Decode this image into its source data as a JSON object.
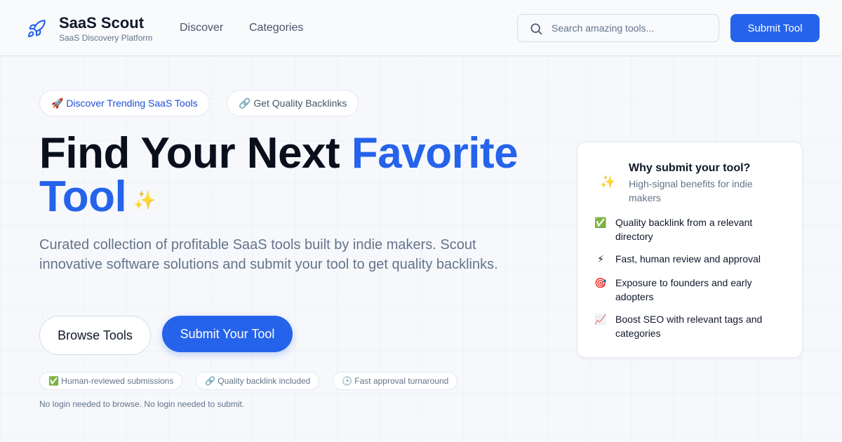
{
  "header": {
    "brand_title": "SaaS Scout",
    "brand_subtitle": "SaaS Discovery Platform",
    "nav": {
      "discover": "Discover",
      "categories": "Categories"
    },
    "search_placeholder": "Search amazing tools...",
    "submit_label": "Submit Tool"
  },
  "hero": {
    "pills": {
      "trending": "🚀 Discover Trending SaaS Tools",
      "backlinks": "🔗 Get Quality Backlinks"
    },
    "headline_plain": "Find Your Next ",
    "headline_accent_1": "Favorite",
    "headline_accent_2": "Tool",
    "headline_emoji": "✨",
    "lead": "Curated collection of profitable SaaS tools built by indie makers. Scout innovative software solutions and submit your tool to get quality backlinks.",
    "browse_label": "Browse Tools",
    "submit_label": "Submit Your Tool",
    "chips": {
      "reviewed": "✅ Human-reviewed submissions",
      "backlink": "🔗 Quality backlink included",
      "approval": "🕒 Fast approval turnaround"
    },
    "note": "No login needed to browse. No login needed to submit."
  },
  "card": {
    "emoji": "✨",
    "title": "Why submit your tool?",
    "subtitle": "High-signal benefits for indie makers",
    "benefits": [
      {
        "icon": "✅",
        "text": "Quality backlink from a relevant directory"
      },
      {
        "icon": "⚡",
        "text": "Fast, human review and approval"
      },
      {
        "icon": "🎯",
        "text": "Exposure to founders and early adopters"
      },
      {
        "icon": "📈",
        "text": "Boost SEO with relevant tags and categories"
      }
    ]
  },
  "colors": {
    "accent": "#2563eb",
    "text": "#0f172a",
    "muted": "#64748b"
  }
}
